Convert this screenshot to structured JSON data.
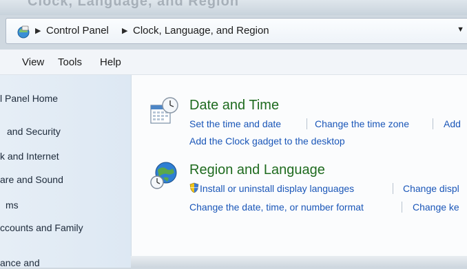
{
  "address_bar": {
    "breadcrumb": [
      "Control Panel",
      "Clock, Language, and Region"
    ],
    "nav_icon": "control-panel-icon",
    "dropdown_icon": "chevron-down-icon"
  },
  "background_heading": "Clock, Language, and Region",
  "menu": {
    "items": [
      "View",
      "Tools",
      "Help"
    ]
  },
  "sidebar": {
    "items": [
      "l Panel Home",
      "and Security",
      "k and Internet",
      "are and Sound",
      "ms",
      "ccounts and Family",
      "ance and"
    ]
  },
  "categories": [
    {
      "title": "Date and Time",
      "icon": "calendar-clock-icon",
      "links": [
        "Set the time and date",
        "Change the time zone",
        "Add",
        "Add the Clock gadget to the desktop"
      ]
    },
    {
      "title": "Region and Language",
      "icon": "globe-clock-icon",
      "links": [
        "Install or uninstall display languages",
        "Change displ",
        "Change the date, time, or number format",
        "Change ke"
      ]
    }
  ],
  "colors": {
    "category_title": "#1f6b1f",
    "link": "#1a56b8",
    "sidebar_bg": "#e6eef6"
  }
}
